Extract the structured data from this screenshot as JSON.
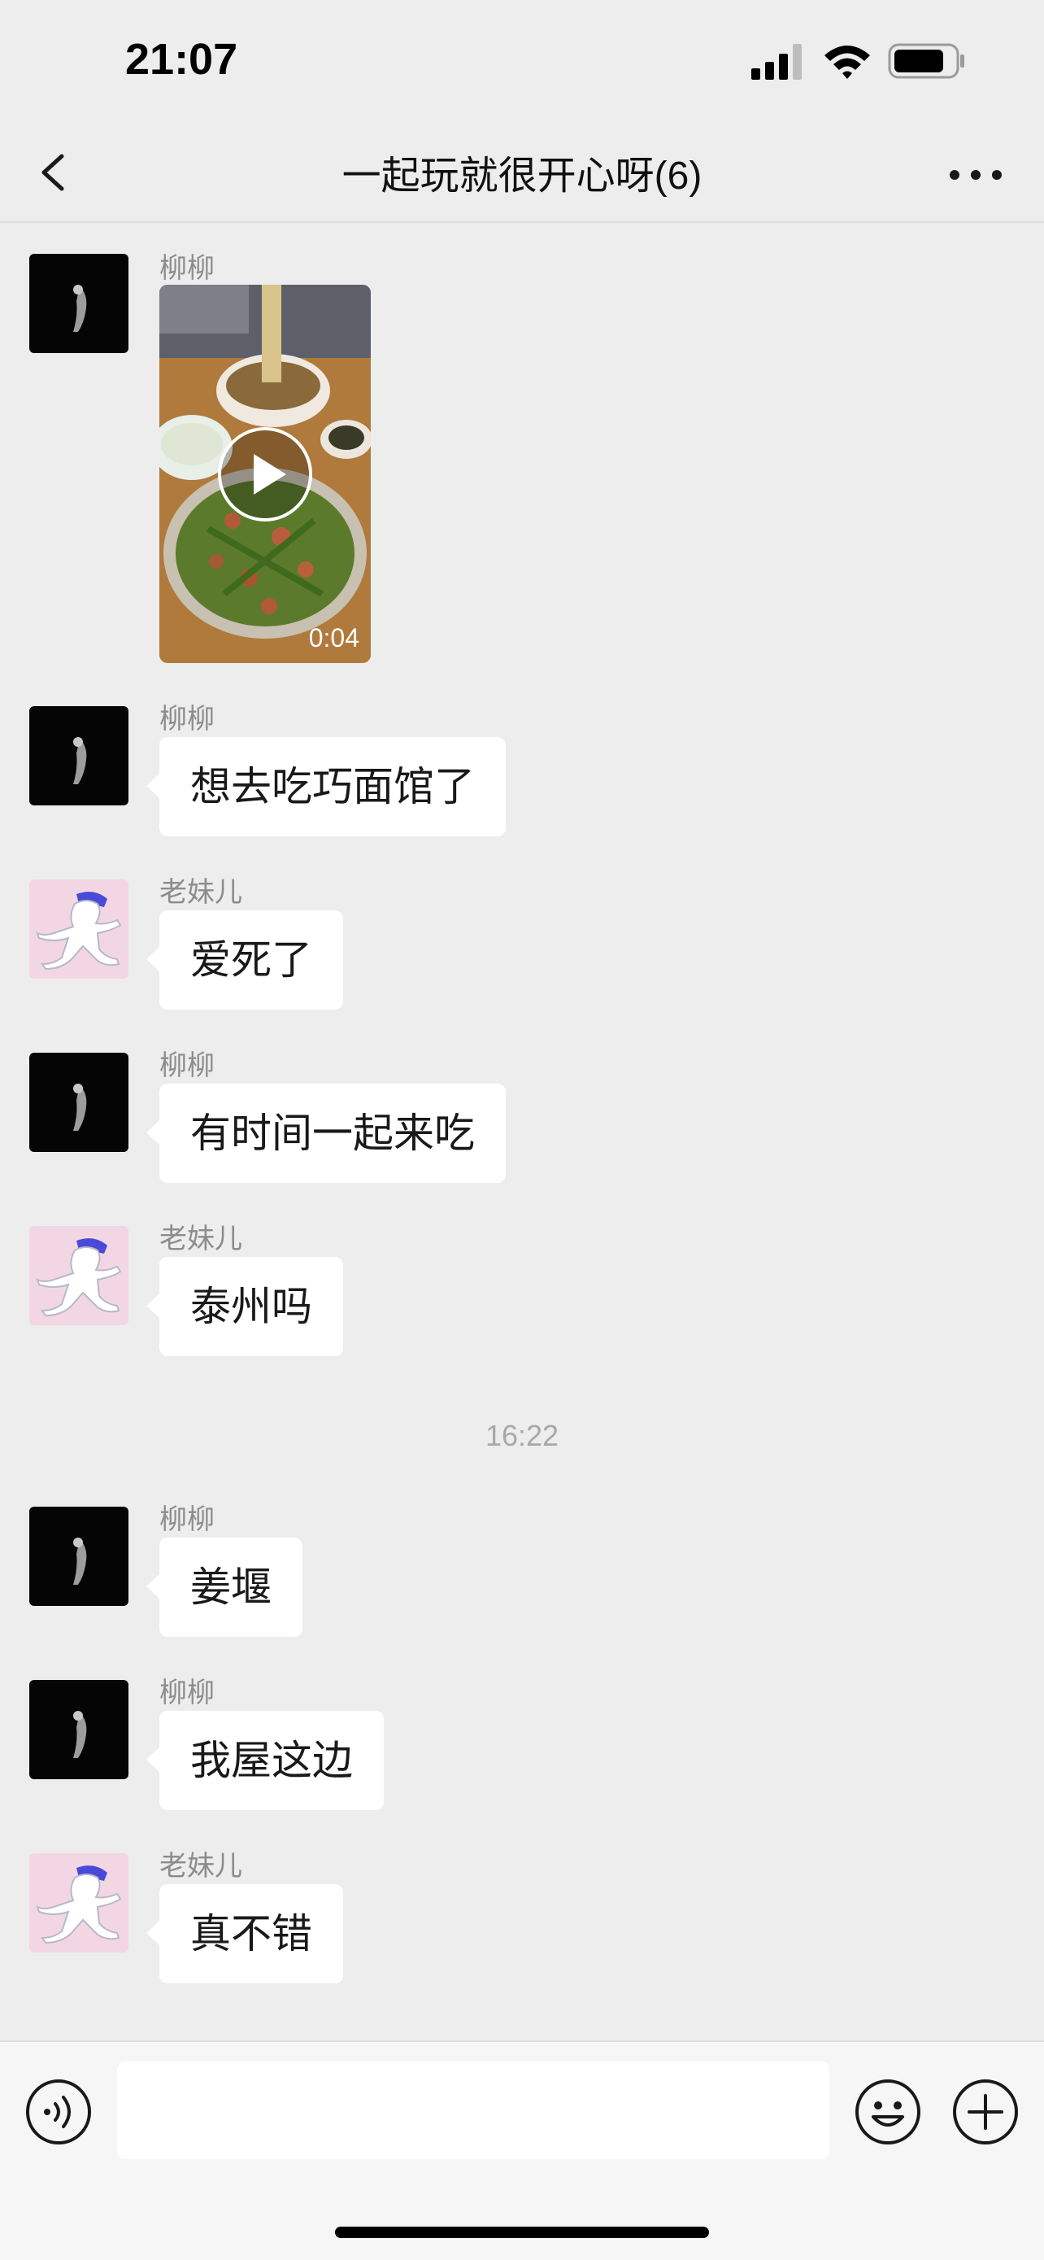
{
  "status_bar": {
    "time": "21:07",
    "icons": [
      "signal-icon",
      "wifi-icon",
      "battery-icon"
    ]
  },
  "nav": {
    "title": "一起玩就很开心呀(6)",
    "back_icon": "chevron-left-icon",
    "more_icon": "more-dots-icon"
  },
  "messages": [
    {
      "sender": "柳柳",
      "type": "video",
      "duration": "0:04",
      "avatar": "dark"
    },
    {
      "sender": "柳柳",
      "type": "text",
      "text": "想去吃巧面馆了",
      "avatar": "dark"
    },
    {
      "sender": "老妹儿",
      "type": "text",
      "text": "爱死了",
      "avatar": "cartoon"
    },
    {
      "sender": "柳柳",
      "type": "text",
      "text": "有时间一起来吃",
      "avatar": "dark"
    },
    {
      "sender": "老妹儿",
      "type": "text",
      "text": "泰州吗",
      "avatar": "cartoon"
    },
    {
      "sender": "柳柳",
      "type": "text",
      "text": "姜堰",
      "avatar": "dark"
    },
    {
      "sender": "柳柳",
      "type": "text",
      "text": "我屋这边",
      "avatar": "dark"
    },
    {
      "sender": "老妹儿",
      "type": "text",
      "text": "真不错",
      "avatar": "cartoon"
    }
  ],
  "timestamp": "16:22",
  "input_bar": {
    "input_value": "",
    "icons": [
      "voice-icon",
      "emoji-icon",
      "plus-icon"
    ]
  },
  "colors": {
    "background": "#ededed",
    "bubble": "#ffffff",
    "sender_name": "#8c8c8c",
    "timestamp": "#a8a8a8",
    "cartoon_avatar_bg": "#f3d6e4",
    "cartoon_hair": "#4a4ad8"
  }
}
